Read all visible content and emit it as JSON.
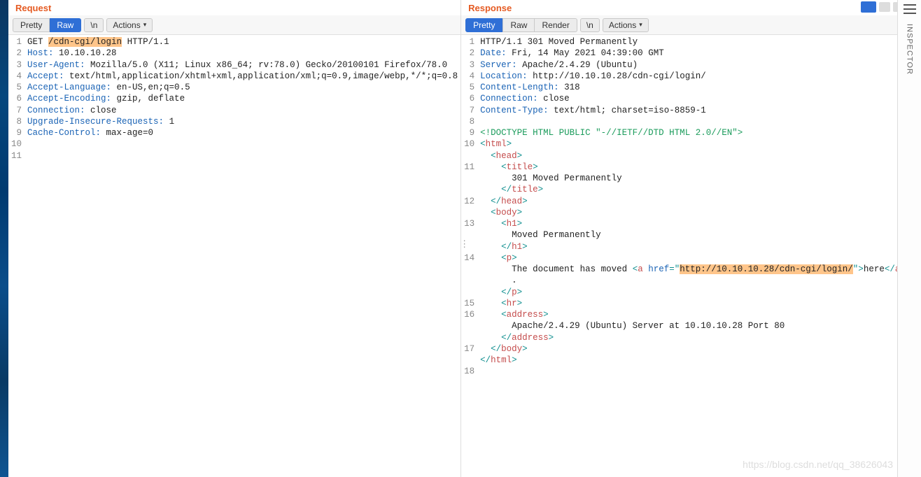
{
  "watermark": "https://blog.csdn.net/qq_38626043",
  "right_rail": {
    "label": "INSPECTOR"
  },
  "request": {
    "title": "Request",
    "toolbar": {
      "pretty": "Pretty",
      "raw": "Raw",
      "newline": "\\n",
      "actions": "Actions"
    },
    "lines": [
      {
        "num": 1,
        "segments": [
          {
            "t": "GET ",
            "c": "k-black"
          },
          {
            "t": "/cdn-cgi/login",
            "c": "k-black hl"
          },
          {
            "t": " HTTP/1.1",
            "c": "k-black"
          }
        ]
      },
      {
        "num": 2,
        "segments": [
          {
            "t": "Host:",
            "c": "k-blue"
          },
          {
            "t": " 10.10.10.28",
            "c": "k-black"
          }
        ]
      },
      {
        "num": 3,
        "segments": [
          {
            "t": "User-Agent:",
            "c": "k-blue"
          },
          {
            "t": " Mozilla/5.0 (X11; Linux x86_64; rv:78.0) Gecko/20100101 Firefox/78.0",
            "c": "k-black"
          }
        ]
      },
      {
        "num": 4,
        "segments": [
          {
            "t": "Accept:",
            "c": "k-blue"
          },
          {
            "t": " text/html,application/xhtml+xml,application/xml;q=0.9,image/webp,*/*;q=0.8",
            "c": "k-black"
          }
        ]
      },
      {
        "num": 5,
        "segments": [
          {
            "t": "Accept-Language:",
            "c": "k-blue"
          },
          {
            "t": " en-US,en;q=0.5",
            "c": "k-black"
          }
        ]
      },
      {
        "num": 6,
        "segments": [
          {
            "t": "Accept-Encoding:",
            "c": "k-blue"
          },
          {
            "t": " gzip, deflate",
            "c": "k-black"
          }
        ]
      },
      {
        "num": 7,
        "segments": [
          {
            "t": "Connection:",
            "c": "k-blue"
          },
          {
            "t": " close",
            "c": "k-black"
          }
        ]
      },
      {
        "num": 8,
        "segments": [
          {
            "t": "Upgrade-Insecure-Requests:",
            "c": "k-blue"
          },
          {
            "t": " 1",
            "c": "k-black"
          }
        ]
      },
      {
        "num": 9,
        "segments": [
          {
            "t": "Cache-Control:",
            "c": "k-blue"
          },
          {
            "t": " max-age=0",
            "c": "k-black"
          }
        ]
      },
      {
        "num": 10,
        "segments": []
      },
      {
        "num": 11,
        "segments": []
      }
    ]
  },
  "response": {
    "title": "Response",
    "toolbar": {
      "pretty": "Pretty",
      "raw": "Raw",
      "render": "Render",
      "newline": "\\n",
      "actions": "Actions"
    },
    "lines": [
      {
        "num": 1,
        "segments": [
          {
            "t": "HTTP/1.1 301 Moved Permanently",
            "c": "k-black"
          }
        ]
      },
      {
        "num": 2,
        "segments": [
          {
            "t": "Date:",
            "c": "k-blue"
          },
          {
            "t": " Fri, 14 May 2021 04:39:00 GMT",
            "c": "k-black"
          }
        ]
      },
      {
        "num": 3,
        "segments": [
          {
            "t": "Server:",
            "c": "k-blue"
          },
          {
            "t": " Apache/2.4.29 (Ubuntu)",
            "c": "k-black"
          }
        ]
      },
      {
        "num": 4,
        "segments": [
          {
            "t": "Location:",
            "c": "k-blue"
          },
          {
            "t": " http://10.10.10.28/cdn-cgi/login/",
            "c": "k-black"
          }
        ]
      },
      {
        "num": 5,
        "segments": [
          {
            "t": "Content-Length:",
            "c": "k-blue"
          },
          {
            "t": " 318",
            "c": "k-black"
          }
        ]
      },
      {
        "num": 6,
        "segments": [
          {
            "t": "Connection:",
            "c": "k-blue"
          },
          {
            "t": " close",
            "c": "k-black"
          }
        ]
      },
      {
        "num": 7,
        "segments": [
          {
            "t": "Content-Type:",
            "c": "k-blue"
          },
          {
            "t": " text/html; charset=iso-8859-1",
            "c": "k-black"
          }
        ]
      },
      {
        "num": 8,
        "segments": []
      },
      {
        "num": 9,
        "segments": [
          {
            "t": "<!DOCTYPE HTML PUBLIC \"-//IETF//DTD HTML 2.0//EN\">",
            "c": "k-green"
          }
        ]
      },
      {
        "num": 10,
        "segments": [
          {
            "t": "<",
            "c": "k-teal"
          },
          {
            "t": "html",
            "c": "k-red"
          },
          {
            "t": ">",
            "c": "k-teal"
          }
        ]
      },
      {
        "num": "",
        "segments": [
          {
            "t": "  <",
            "c": "k-teal"
          },
          {
            "t": "head",
            "c": "k-red"
          },
          {
            "t": ">",
            "c": "k-teal"
          }
        ]
      },
      {
        "num": 11,
        "segments": [
          {
            "t": "    <",
            "c": "k-teal"
          },
          {
            "t": "title",
            "c": "k-red"
          },
          {
            "t": ">",
            "c": "k-teal"
          }
        ]
      },
      {
        "num": "",
        "segments": [
          {
            "t": "      301 Moved Permanently",
            "c": "k-black"
          }
        ]
      },
      {
        "num": "",
        "segments": [
          {
            "t": "    </",
            "c": "k-teal"
          },
          {
            "t": "title",
            "c": "k-red"
          },
          {
            "t": ">",
            "c": "k-teal"
          }
        ]
      },
      {
        "num": 12,
        "segments": [
          {
            "t": "  </",
            "c": "k-teal"
          },
          {
            "t": "head",
            "c": "k-red"
          },
          {
            "t": ">",
            "c": "k-teal"
          }
        ]
      },
      {
        "num": "",
        "segments": [
          {
            "t": "  <",
            "c": "k-teal"
          },
          {
            "t": "body",
            "c": "k-red"
          },
          {
            "t": ">",
            "c": "k-teal"
          }
        ]
      },
      {
        "num": 13,
        "segments": [
          {
            "t": "    <",
            "c": "k-teal"
          },
          {
            "t": "h1",
            "c": "k-red"
          },
          {
            "t": ">",
            "c": "k-teal"
          }
        ]
      },
      {
        "num": "",
        "segments": [
          {
            "t": "      Moved Permanently",
            "c": "k-black"
          }
        ]
      },
      {
        "num": "",
        "segments": [
          {
            "t": "    </",
            "c": "k-teal"
          },
          {
            "t": "h1",
            "c": "k-red"
          },
          {
            "t": ">",
            "c": "k-teal"
          }
        ]
      },
      {
        "num": 14,
        "segments": [
          {
            "t": "    <",
            "c": "k-teal"
          },
          {
            "t": "p",
            "c": "k-red"
          },
          {
            "t": ">",
            "c": "k-teal"
          }
        ]
      },
      {
        "num": "",
        "segments": [
          {
            "t": "      The document has moved ",
            "c": "k-black"
          },
          {
            "t": "<",
            "c": "k-teal"
          },
          {
            "t": "a",
            "c": "k-red"
          },
          {
            "t": " href",
            "c": "k-blue"
          },
          {
            "t": "=\"",
            "c": "k-teal"
          },
          {
            "t": "http://10.10.10.28/cdn-cgi/login/",
            "c": "k-black hl"
          },
          {
            "t": "\">",
            "c": "k-teal"
          },
          {
            "t": "here",
            "c": "k-black"
          },
          {
            "t": "</",
            "c": "k-teal"
          },
          {
            "t": "a",
            "c": "k-red"
          },
          {
            "t": ">",
            "c": "k-teal"
          }
        ]
      },
      {
        "num": "",
        "segments": [
          {
            "t": "      .",
            "c": "k-black"
          }
        ]
      },
      {
        "num": "",
        "segments": [
          {
            "t": "    </",
            "c": "k-teal"
          },
          {
            "t": "p",
            "c": "k-red"
          },
          {
            "t": ">",
            "c": "k-teal"
          }
        ]
      },
      {
        "num": 15,
        "segments": [
          {
            "t": "    <",
            "c": "k-teal"
          },
          {
            "t": "hr",
            "c": "k-red"
          },
          {
            "t": ">",
            "c": "k-teal"
          }
        ]
      },
      {
        "num": 16,
        "segments": [
          {
            "t": "    <",
            "c": "k-teal"
          },
          {
            "t": "address",
            "c": "k-red"
          },
          {
            "t": ">",
            "c": "k-teal"
          }
        ]
      },
      {
        "num": "",
        "segments": [
          {
            "t": "      Apache/2.4.29 (Ubuntu) Server at 10.10.10.28 Port 80",
            "c": "k-black"
          }
        ]
      },
      {
        "num": "",
        "segments": [
          {
            "t": "    </",
            "c": "k-teal"
          },
          {
            "t": "address",
            "c": "k-red"
          },
          {
            "t": ">",
            "c": "k-teal"
          }
        ]
      },
      {
        "num": 17,
        "segments": [
          {
            "t": "  </",
            "c": "k-teal"
          },
          {
            "t": "body",
            "c": "k-red"
          },
          {
            "t": ">",
            "c": "k-teal"
          }
        ]
      },
      {
        "num": "",
        "segments": [
          {
            "t": "</",
            "c": "k-teal"
          },
          {
            "t": "html",
            "c": "k-red"
          },
          {
            "t": ">",
            "c": "k-teal"
          }
        ]
      },
      {
        "num": 18,
        "segments": []
      }
    ]
  }
}
